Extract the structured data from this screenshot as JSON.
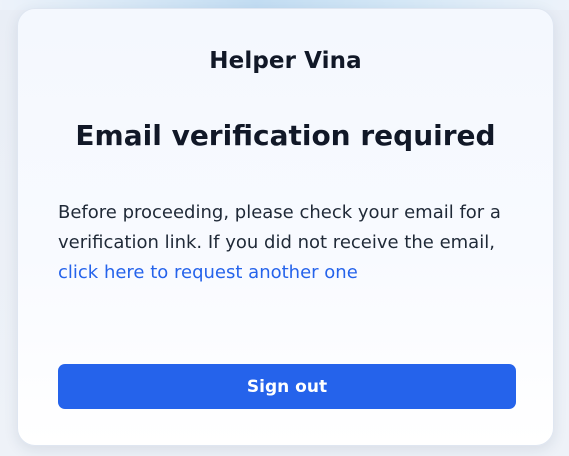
{
  "app": {
    "name": "Helper Vina"
  },
  "verification": {
    "title": "Email verification required",
    "message_text": "Before proceeding, please check your email for a verification link. If you did not receive the email, ",
    "resend_link_label": "click here to request another one"
  },
  "actions": {
    "sign_out_label": "Sign out"
  },
  "colors": {
    "accent": "#2563eb",
    "text": "#111827",
    "card_bg": "#f8faff"
  }
}
